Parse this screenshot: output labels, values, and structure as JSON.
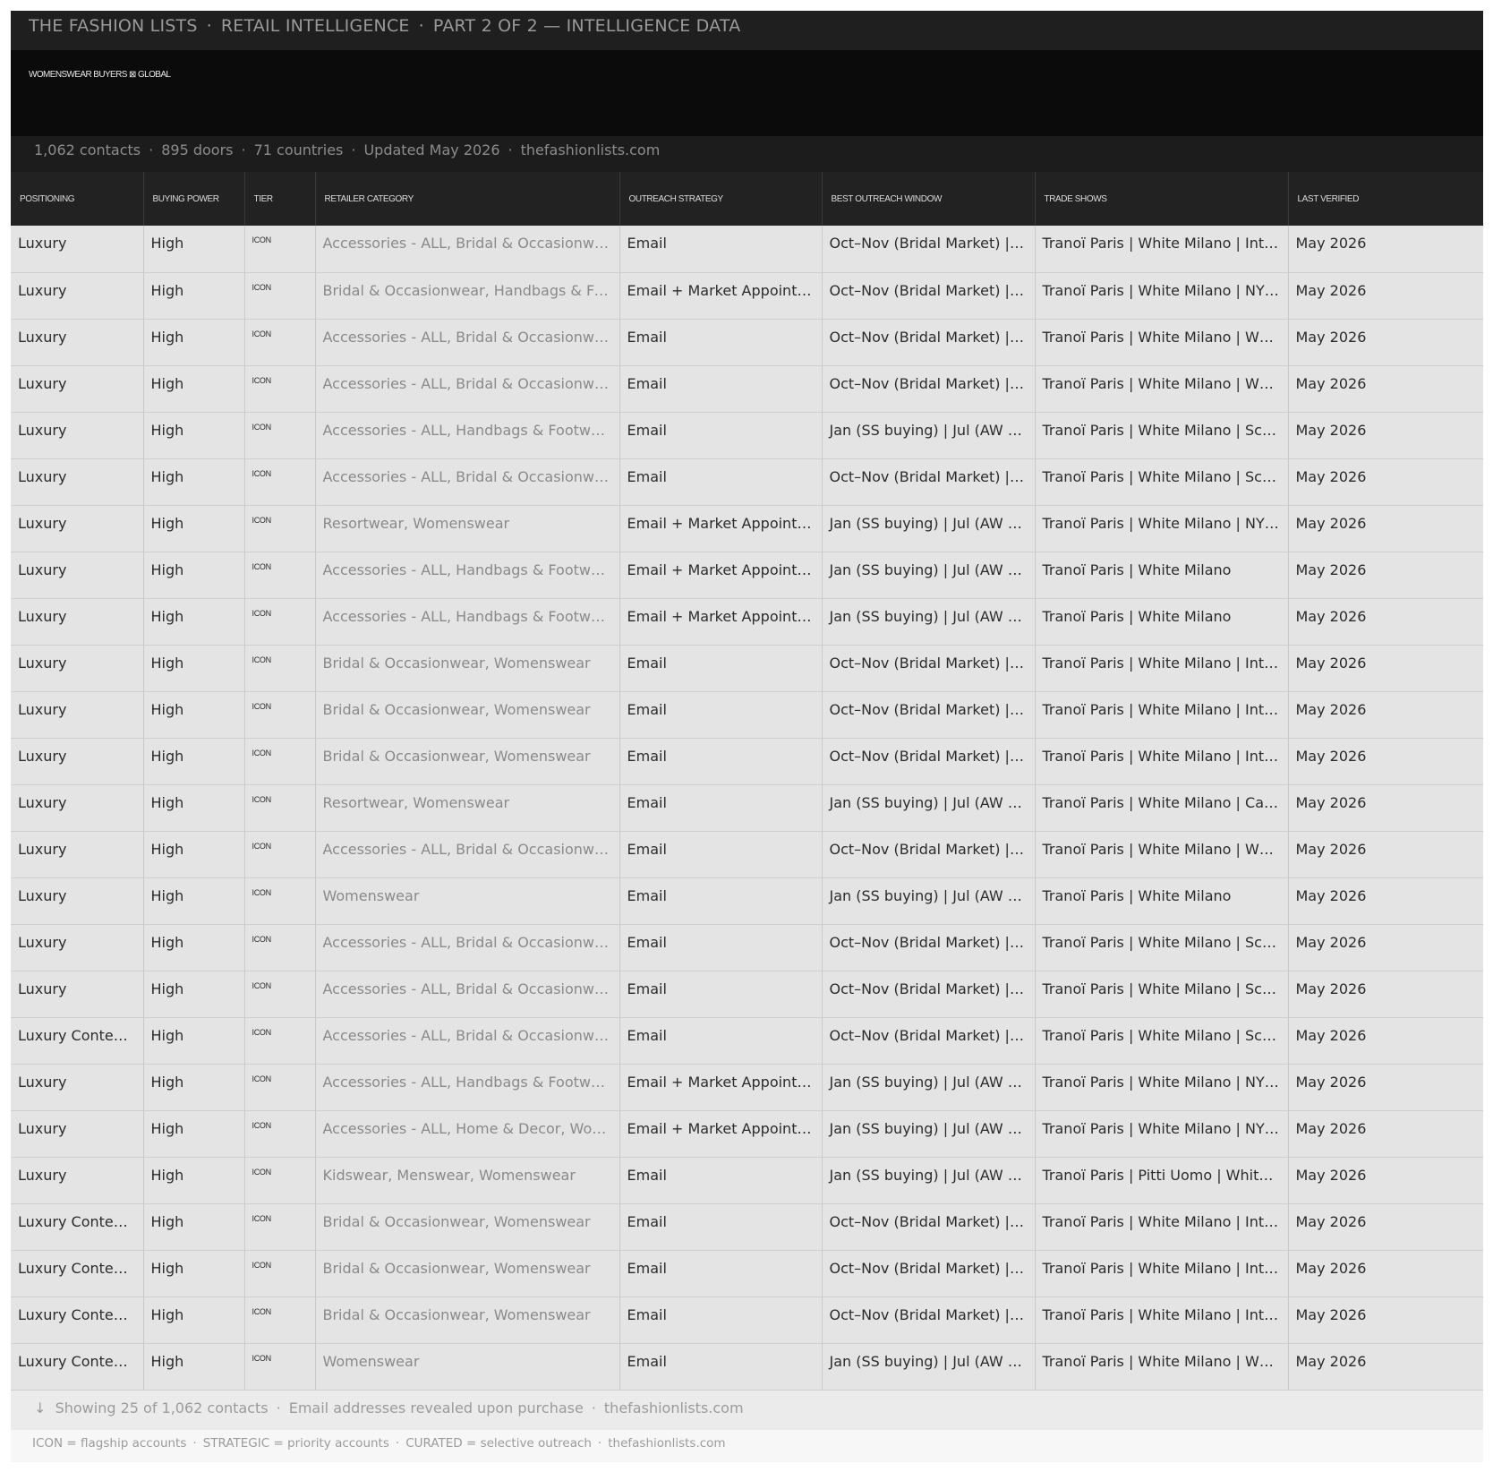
{
  "header": {
    "brand": "THE FASHION LISTS",
    "section": "RETAIL INTELLIGENCE",
    "part": "PART 2 OF 2 — INTELLIGENCE DATA",
    "separator": "·"
  },
  "hero": {
    "kicker": "WOMENSWEAR BUYERS ⊠ GLOBAL"
  },
  "stats": {
    "contacts": "1,062 contacts",
    "doors": "895 doors",
    "countries": "71 countries",
    "updated": "Updated May 2026",
    "site": "thefashionlists.com"
  },
  "table": {
    "columns": [
      "Positioning",
      "Buying Power",
      "Tier",
      "Retailer Category",
      "Outreach Strategy",
      "Best Outreach Window",
      "Trade Shows",
      "Last Verified"
    ],
    "rows": [
      [
        "Luxury",
        "High",
        "ICON",
        "Accessories - ALL, Bridal & Occasionwear, Handbags & Footwear, Womenswear",
        "Email",
        "Oct–Nov (Bridal Market) | Apr–May (Bridal Market)",
        "Tranoï Paris | White Milano | International Bridal",
        "May 2026"
      ],
      [
        "Luxury",
        "High",
        "ICON",
        "Bridal & Occasionwear, Handbags & Footwear, Womenswear",
        "Email + Market Appointments",
        "Oct–Nov (Bridal Market) | Apr–May (Bridal Market)",
        "Tranoï Paris | White Milano | NY Market",
        "May 2026"
      ],
      [
        "Luxury",
        "High",
        "ICON",
        "Accessories - ALL, Bridal & Occasionwear, Womenswear",
        "Email",
        "Oct–Nov (Bridal Market) | Apr–May (Bridal Market)",
        "Tranoï Paris | White Milano | Who's Next",
        "May 2026"
      ],
      [
        "Luxury",
        "High",
        "ICON",
        "Accessories - ALL, Bridal & Occasionwear, Womenswear",
        "Email",
        "Oct–Nov (Bridal Market) | Apr–May (Bridal Market)",
        "Tranoï Paris | White Milano | Who's Next",
        "May 2026"
      ],
      [
        "Luxury",
        "High",
        "ICON",
        "Accessories - ALL, Handbags & Footwear, Womenswear",
        "Email",
        "Jan (SS buying) | Jul (AW buying)",
        "Tranoï Paris | White Milano | Scoop",
        "May 2026"
      ],
      [
        "Luxury",
        "High",
        "ICON",
        "Accessories - ALL, Bridal & Occasionwear, Womenswear",
        "Email",
        "Oct–Nov (Bridal Market) | Apr–May (Bridal Market)",
        "Tranoï Paris | White Milano | Scoop",
        "May 2026"
      ],
      [
        "Luxury",
        "High",
        "ICON",
        "Resortwear, Womenswear",
        "Email + Market Appointments",
        "Jan (SS buying) | Jul (AW buying)",
        "Tranoï Paris | White Milano | NY Market",
        "May 2026"
      ],
      [
        "Luxury",
        "High",
        "ICON",
        "Accessories - ALL, Handbags & Footwear, Womenswear",
        "Email + Market Appointments",
        "Jan (SS buying) | Jul (AW buying)",
        "Tranoï Paris | White Milano",
        "May 2026"
      ],
      [
        "Luxury",
        "High",
        "ICON",
        "Accessories - ALL, Handbags & Footwear, Womenswear",
        "Email + Market Appointments",
        "Jan (SS buying) | Jul (AW buying)",
        "Tranoï Paris | White Milano",
        "May 2026"
      ],
      [
        "Luxury",
        "High",
        "ICON",
        "Bridal & Occasionwear, Womenswear",
        "Email",
        "Oct–Nov (Bridal Market) | Apr–May (Bridal Market)",
        "Tranoï Paris | White Milano | International Bridal",
        "May 2026"
      ],
      [
        "Luxury",
        "High",
        "ICON",
        "Bridal & Occasionwear, Womenswear",
        "Email",
        "Oct–Nov (Bridal Market) | Apr–May (Bridal Market)",
        "Tranoï Paris | White Milano | International Bridal",
        "May 2026"
      ],
      [
        "Luxury",
        "High",
        "ICON",
        "Bridal & Occasionwear, Womenswear",
        "Email",
        "Oct–Nov (Bridal Market) | Apr–May (Bridal Market)",
        "Tranoï Paris | White Milano | International Bridal",
        "May 2026"
      ],
      [
        "Luxury",
        "High",
        "ICON",
        "Resortwear, Womenswear",
        "Email",
        "Jan (SS buying) | Jul (AW buying)",
        "Tranoï Paris | White Milano | Cabana",
        "May 2026"
      ],
      [
        "Luxury",
        "High",
        "ICON",
        "Accessories - ALL, Bridal & Occasionwear, Womenswear",
        "Email",
        "Oct–Nov (Bridal Market) | Apr–May (Bridal Market)",
        "Tranoï Paris | White Milano | Who's Next",
        "May 2026"
      ],
      [
        "Luxury",
        "High",
        "ICON",
        "Womenswear",
        "Email",
        "Jan (SS buying) | Jul (AW buying)",
        "Tranoï Paris | White Milano",
        "May 2026"
      ],
      [
        "Luxury",
        "High",
        "ICON",
        "Accessories - ALL, Bridal & Occasionwear, Womenswear",
        "Email",
        "Oct–Nov (Bridal Market) | Apr–May (Bridal Market)",
        "Tranoï Paris | White Milano | Scoop",
        "May 2026"
      ],
      [
        "Luxury",
        "High",
        "ICON",
        "Accessories - ALL, Bridal & Occasionwear, Womenswear",
        "Email",
        "Oct–Nov (Bridal Market) | Apr–May (Bridal Market)",
        "Tranoï Paris | White Milano | Scoop",
        "May 2026"
      ],
      [
        "Luxury Contemporary",
        "High",
        "ICON",
        "Accessories - ALL, Bridal & Occasionwear, Womenswear",
        "Email",
        "Oct–Nov (Bridal Market) | Apr–May (Bridal Market)",
        "Tranoï Paris | White Milano | Scoop",
        "May 2026"
      ],
      [
        "Luxury",
        "High",
        "ICON",
        "Accessories - ALL, Handbags & Footwear, Womenswear",
        "Email + Market Appointments",
        "Jan (SS buying) | Jul (AW buying)",
        "Tranoï Paris | White Milano | NY Market",
        "May 2026"
      ],
      [
        "Luxury",
        "High",
        "ICON",
        "Accessories - ALL, Home & Decor, Womenswear",
        "Email + Market Appointments",
        "Jan (SS buying) | Jul (AW buying)",
        "Tranoï Paris | White Milano | NY Market",
        "May 2026"
      ],
      [
        "Luxury",
        "High",
        "ICON",
        "Kidswear, Menswear, Womenswear",
        "Email",
        "Jan (SS buying) | Jul (AW buying)",
        "Tranoï Paris | Pitti Uomo | White Milano",
        "May 2026"
      ],
      [
        "Luxury Contemporary",
        "High",
        "ICON",
        "Bridal & Occasionwear, Womenswear",
        "Email",
        "Oct–Nov (Bridal Market) | Apr–May (Bridal Market)",
        "Tranoï Paris | White Milano | International Bridal",
        "May 2026"
      ],
      [
        "Luxury Contemporary",
        "High",
        "ICON",
        "Bridal & Occasionwear, Womenswear",
        "Email",
        "Oct–Nov (Bridal Market) | Apr–May (Bridal Market)",
        "Tranoï Paris | White Milano | International Bridal",
        "May 2026"
      ],
      [
        "Luxury Contemporary",
        "High",
        "ICON",
        "Bridal & Occasionwear, Womenswear",
        "Email",
        "Oct–Nov (Bridal Market) | Apr–May (Bridal Market)",
        "Tranoï Paris | White Milano | International Bridal",
        "May 2026"
      ],
      [
        "Luxury Contemporary",
        "High",
        "ICON",
        "Womenswear",
        "Email",
        "Jan (SS buying) | Jul (AW buying)",
        "Tranoï Paris | White Milano | Who's Next",
        "May 2026"
      ]
    ]
  },
  "footer": {
    "arrow": "↓",
    "showing": "Showing 25 of 1,062 contacts",
    "email_note": "Email addresses revealed upon purchase",
    "site": "thefashionlists.com",
    "legend_icon": "ICON = flagship accounts",
    "legend_strategic": "STRATEGIC = priority accounts",
    "legend_curated": "CURATED = selective outreach",
    "legend_site": "thefashionlists.com"
  },
  "colors": {
    "topbar_bg": "#1f1f1f",
    "hero_bg": "#0b0b0b",
    "header_row_bg": "#222222",
    "row_bg": "#e4e4e4",
    "muted_text": "#8a8a8a"
  }
}
